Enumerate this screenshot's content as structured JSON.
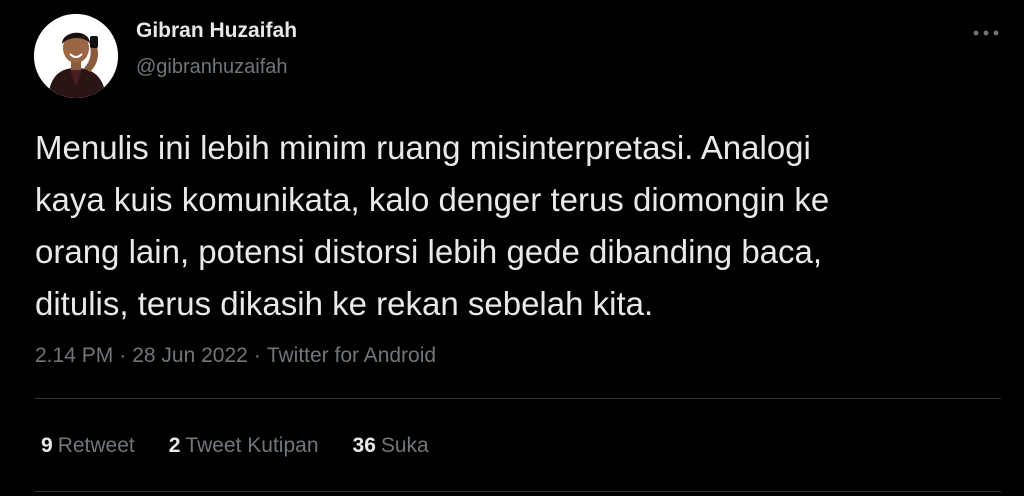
{
  "author": {
    "display_name": "Gibran Huzaifah",
    "handle": "@gibranhuzaifah"
  },
  "tweet": {
    "text": "Menulis ini lebih minim ruang misinterpretasi. Analogi\nkaya kuis komunikata, kalo denger terus diomongin ke\norang lain, potensi distorsi lebih gede dibanding baca,\nditulis, terus dikasih ke rekan sebelah kita.",
    "time": "2.14 PM",
    "separator": "·",
    "date": "28 Jun 2022",
    "source": "Twitter for Android"
  },
  "stats": {
    "retweets": {
      "count": "9",
      "label": "Retweet"
    },
    "quotes": {
      "count": "2",
      "label": "Tweet Kutipan"
    },
    "likes": {
      "count": "36",
      "label": "Suka"
    }
  },
  "icons": {
    "more": "more-horizontal-icon"
  },
  "colors": {
    "background": "#000000",
    "primary_text": "#e7e9ea",
    "secondary_text": "#71767b",
    "divider": "#2f3336"
  }
}
